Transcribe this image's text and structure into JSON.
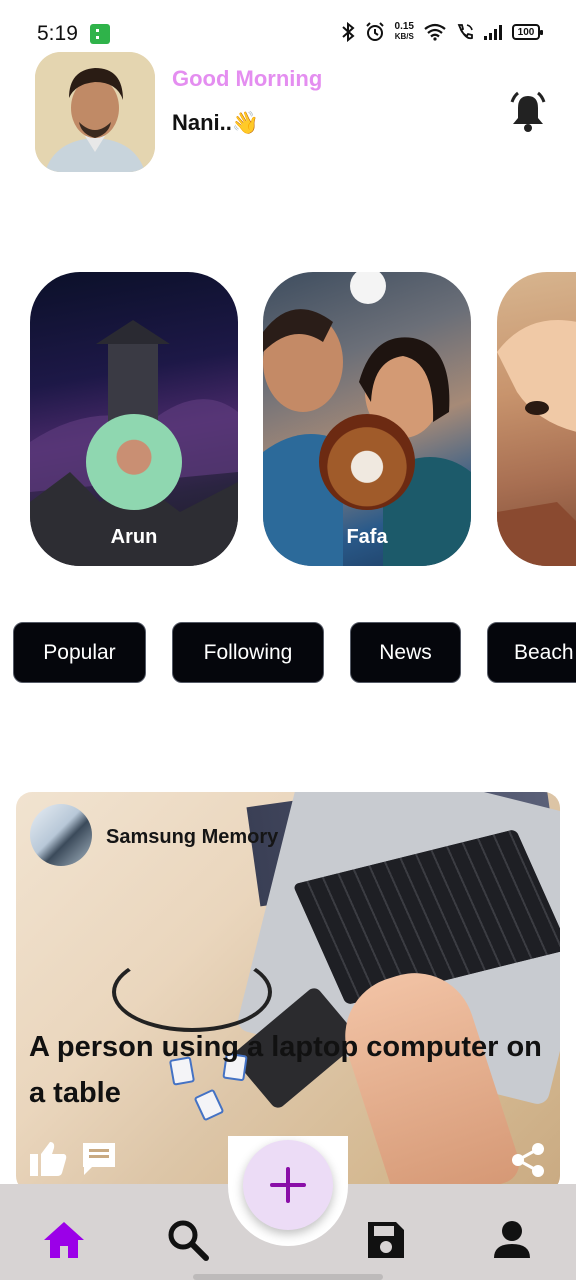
{
  "status_bar": {
    "time": "5:19",
    "speed_value": "0.15",
    "speed_unit": "KB/S",
    "battery": "100"
  },
  "header": {
    "greeting": "Good Morning",
    "username": "Nani..👋",
    "greeting_color": "#e48ef0"
  },
  "stories": [
    {
      "name": "Arun"
    },
    {
      "name": "Fafa"
    },
    {
      "name": ""
    }
  ],
  "tabs": [
    {
      "label": "Popular"
    },
    {
      "label": "Following"
    },
    {
      "label": "News"
    },
    {
      "label": "Beach"
    }
  ],
  "post": {
    "author": "Samsung Memory",
    "title": "A person using a laptop computer on a table"
  },
  "bottom_nav": {
    "items": [
      {
        "icon": "home-icon",
        "active": true
      },
      {
        "icon": "search-icon",
        "active": false
      },
      {
        "icon": "add-icon",
        "active": false
      },
      {
        "icon": "save-icon",
        "active": false
      },
      {
        "icon": "profile-icon",
        "active": false
      }
    ],
    "accent_color": "#9b00e8"
  }
}
